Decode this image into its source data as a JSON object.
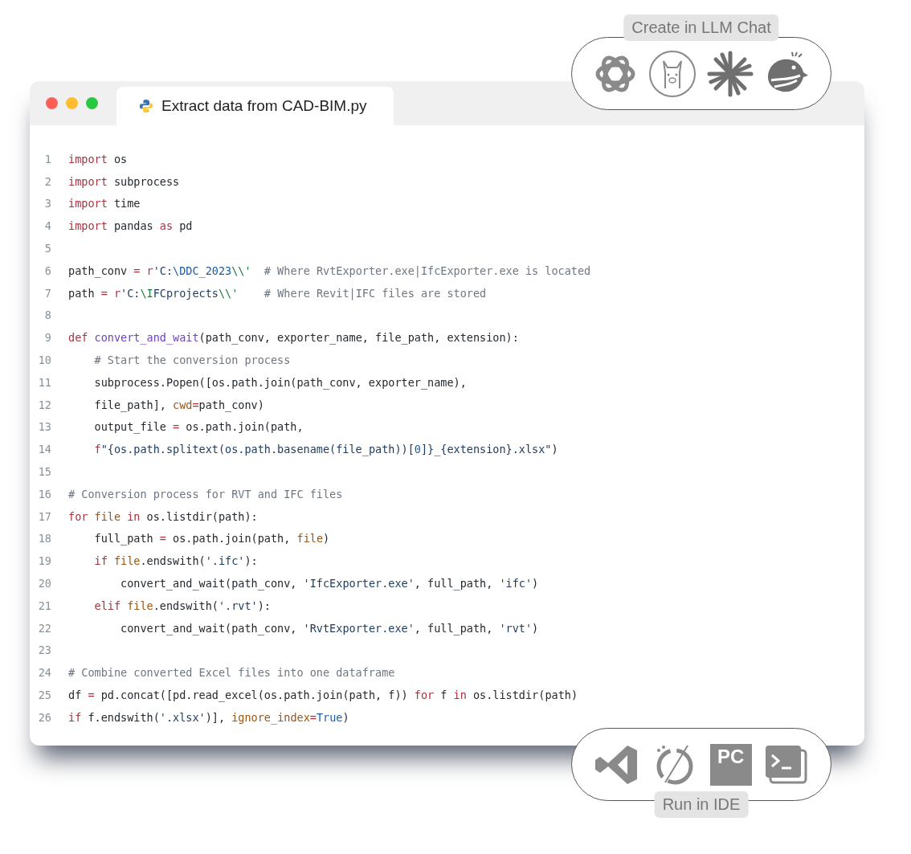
{
  "window": {
    "controls": [
      {
        "color": "#ff5f57"
      },
      {
        "color": "#febc2e"
      },
      {
        "color": "#28c840"
      }
    ],
    "tab": {
      "title": "Extract data from CAD-BIM.py"
    }
  },
  "code": [
    {
      "number": "1",
      "tokens": [
        {
          "kind": "keyword",
          "text": "import"
        },
        {
          "kind": "plain",
          "text": " os"
        }
      ]
    },
    {
      "number": "2",
      "tokens": [
        {
          "kind": "keyword",
          "text": "import"
        },
        {
          "kind": "plain",
          "text": " subprocess"
        }
      ]
    },
    {
      "number": "3",
      "tokens": [
        {
          "kind": "keyword",
          "text": "import"
        },
        {
          "kind": "plain",
          "text": " time"
        }
      ]
    },
    {
      "number": "4",
      "tokens": [
        {
          "kind": "keyword",
          "text": "import"
        },
        {
          "kind": "plain",
          "text": " pandas "
        },
        {
          "kind": "keyword",
          "text": "as"
        },
        {
          "kind": "plain",
          "text": " pd"
        }
      ]
    },
    {
      "number": "5"
    },
    {
      "number": "6",
      "tokens": [
        {
          "kind": "plain",
          "text": "path_conv "
        },
        {
          "kind": "keyword",
          "text": "= r"
        },
        {
          "kind": "string",
          "text": "'C:"
        },
        {
          "kind": "constant",
          "text": "\\DDC_2023"
        },
        {
          "kind": "escape",
          "text": "\\\\'"
        },
        {
          "kind": "comment",
          "text": "  # Where RvtExporter.exe|IfcExporter.exe is located"
        }
      ]
    },
    {
      "number": "7",
      "tokens": [
        {
          "kind": "plain",
          "text": "path "
        },
        {
          "kind": "keyword",
          "text": "= r"
        },
        {
          "kind": "string",
          "text": "'C:"
        },
        {
          "kind": "escape",
          "text": "\\I"
        },
        {
          "kind": "string",
          "text": "FCprojects"
        },
        {
          "kind": "escape",
          "text": "\\\\'"
        },
        {
          "kind": "comment",
          "text": "    # Where Revit|IFC files are stored"
        }
      ]
    },
    {
      "number": "8"
    },
    {
      "number": "9",
      "tokens": [
        {
          "kind": "keyword",
          "text": "def "
        },
        {
          "kind": "function",
          "text": "convert_and_wait"
        },
        {
          "kind": "plain",
          "text": "(path_conv, exporter_name, file_path, extension):"
        }
      ]
    },
    {
      "number": "10",
      "tokens": [
        {
          "kind": "comment",
          "text": "    # Start the conversion process"
        }
      ]
    },
    {
      "number": "11",
      "tokens": [
        {
          "kind": "plain",
          "text": "    subprocess.Popen([os.path.join(path_conv, exporter_name),"
        }
      ]
    },
    {
      "number": "12",
      "tokens": [
        {
          "kind": "plain",
          "text": "    file_path], "
        },
        {
          "kind": "argument",
          "text": "cwd"
        },
        {
          "kind": "keyword",
          "text": "="
        },
        {
          "kind": "plain",
          "text": "path_conv)"
        }
      ]
    },
    {
      "number": "13",
      "tokens": [
        {
          "kind": "plain",
          "text": "    output_file "
        },
        {
          "kind": "keyword",
          "text": "="
        },
        {
          "kind": "plain",
          "text": " os.path.join(path,"
        }
      ]
    },
    {
      "number": "14",
      "tokens": [
        {
          "kind": "keyword",
          "text": "    f"
        },
        {
          "kind": "string",
          "text": "\"{os.path.splitext(os.path.basename(file_path))["
        },
        {
          "kind": "constant",
          "text": "0"
        },
        {
          "kind": "string",
          "text": "]}_{extension}.xlsx\""
        },
        {
          "kind": "plain",
          "text": ")"
        }
      ]
    },
    {
      "number": "15"
    },
    {
      "number": "16",
      "tokens": [
        {
          "kind": "comment",
          "text": "# Conversion process for RVT and IFC files"
        }
      ]
    },
    {
      "number": "17",
      "tokens": [
        {
          "kind": "keyword",
          "text": "for "
        },
        {
          "kind": "argument",
          "text": "file "
        },
        {
          "kind": "keyword",
          "text": "in"
        },
        {
          "kind": "plain",
          "text": " os.listdir(path):"
        }
      ]
    },
    {
      "number": "18",
      "tokens": [
        {
          "kind": "plain",
          "text": "    full_path "
        },
        {
          "kind": "keyword",
          "text": "="
        },
        {
          "kind": "plain",
          "text": " os.path.join(path, "
        },
        {
          "kind": "argument",
          "text": "file"
        },
        {
          "kind": "plain",
          "text": ")"
        }
      ]
    },
    {
      "number": "19",
      "tokens": [
        {
          "kind": "keyword",
          "text": "    if "
        },
        {
          "kind": "argument",
          "text": "file"
        },
        {
          "kind": "plain",
          "text": ".endswith("
        },
        {
          "kind": "string",
          "text": "'.ifc'"
        },
        {
          "kind": "plain",
          "text": "):"
        }
      ]
    },
    {
      "number": "20",
      "tokens": [
        {
          "kind": "plain",
          "text": "        convert_and_wait(path_conv, "
        },
        {
          "kind": "string",
          "text": "'IfcExporter.exe'"
        },
        {
          "kind": "plain",
          "text": ", full_path, "
        },
        {
          "kind": "string",
          "text": "'ifc'"
        },
        {
          "kind": "plain",
          "text": ")"
        }
      ]
    },
    {
      "number": "21",
      "tokens": [
        {
          "kind": "keyword",
          "text": "    elif "
        },
        {
          "kind": "argument",
          "text": "file"
        },
        {
          "kind": "plain",
          "text": ".endswith("
        },
        {
          "kind": "string",
          "text": "'.rvt'"
        },
        {
          "kind": "plain",
          "text": "):"
        }
      ]
    },
    {
      "number": "22",
      "tokens": [
        {
          "kind": "plain",
          "text": "        convert_and_wait(path_conv, "
        },
        {
          "kind": "string",
          "text": "'RvtExporter.exe'"
        },
        {
          "kind": "plain",
          "text": ", full_path, "
        },
        {
          "kind": "string",
          "text": "'rvt'"
        },
        {
          "kind": "plain",
          "text": ")"
        }
      ]
    },
    {
      "number": "23"
    },
    {
      "number": "24",
      "tokens": [
        {
          "kind": "comment",
          "text": "# Combine converted Excel files into one dataframe"
        }
      ]
    },
    {
      "number": "25",
      "tokens": [
        {
          "kind": "plain",
          "text": "df "
        },
        {
          "kind": "keyword",
          "text": "="
        },
        {
          "kind": "plain",
          "text": " pd.concat([pd.read_excel(os.path.join(path, f)) "
        },
        {
          "kind": "keyword",
          "text": "for"
        },
        {
          "kind": "plain",
          "text": " f "
        },
        {
          "kind": "keyword",
          "text": "in"
        },
        {
          "kind": "plain",
          "text": " os.listdir(path)"
        }
      ]
    },
    {
      "number": "26",
      "tokens": [
        {
          "kind": "keyword",
          "text": "if"
        },
        {
          "kind": "plain",
          "text": " f.endswith("
        },
        {
          "kind": "string",
          "text": "'.xlsx'"
        },
        {
          "kind": "plain",
          "text": ")], "
        },
        {
          "kind": "argument",
          "text": "ignore_index"
        },
        {
          "kind": "keyword",
          "text": "="
        },
        {
          "kind": "constant",
          "text": "True"
        },
        {
          "kind": "plain",
          "text": ")"
        }
      ]
    }
  ],
  "llm_panel": {
    "label": "Create in LLM Chat"
  },
  "ide_panel": {
    "label": "Run in IDE",
    "pycharm_text": "PC"
  }
}
